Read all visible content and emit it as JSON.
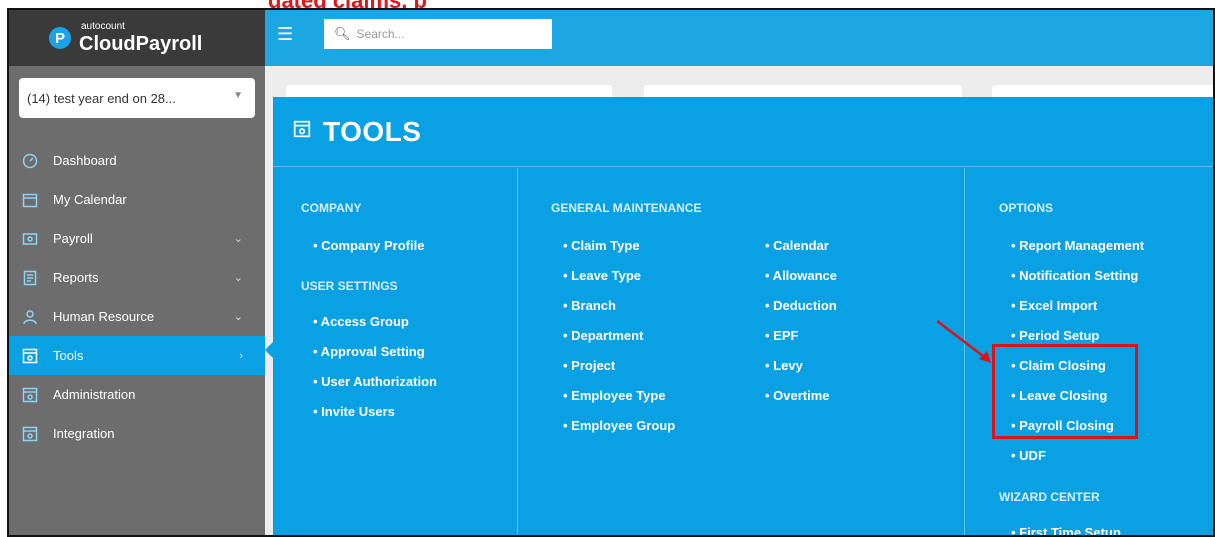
{
  "top_caption": "gated claims, p",
  "brand": {
    "logo_letter": "P",
    "small": "autocount",
    "name": "CloudPayroll"
  },
  "company_select": {
    "value": "(14) test year end on 28..."
  },
  "search": {
    "placeholder": "Search..."
  },
  "sidebar": {
    "items": [
      {
        "label": "Dashboard",
        "icon": "dashboard-icon"
      },
      {
        "label": "My Calendar",
        "icon": "calendar-icon"
      },
      {
        "label": "Payroll",
        "icon": "payroll-icon"
      },
      {
        "label": "Reports",
        "icon": "reports-icon"
      },
      {
        "label": "Human Resource",
        "icon": "human-resource-icon"
      },
      {
        "label": "Tools",
        "icon": "tools-icon"
      },
      {
        "label": "Administration",
        "icon": "administration-icon"
      },
      {
        "label": "Integration",
        "icon": "integration-icon"
      }
    ]
  },
  "tools": {
    "title": "TOOLS",
    "company": {
      "title": "COMPANY",
      "links": [
        "• Company Profile"
      ]
    },
    "user_settings": {
      "title": "USER SETTINGS",
      "links": [
        "• Access Group",
        "• Approval Setting",
        "• User Authorization",
        "• Invite Users"
      ]
    },
    "general_maintenance": {
      "title": "GENERAL MAINTENANCE",
      "col1": [
        "• Claim Type",
        "• Leave Type",
        "• Branch",
        "• Department",
        "• Project",
        "• Employee Type",
        "• Employee Group"
      ],
      "col2": [
        "• Calendar",
        "• Allowance",
        "• Deduction",
        "• EPF",
        "• Levy",
        "• Overtime"
      ]
    },
    "options": {
      "title": "OPTIONS",
      "links": [
        "• Report Management",
        "• Notification Setting",
        "• Excel Import",
        "• Period Setup",
        "• Claim Closing",
        "• Leave Closing",
        "• Payroll Closing",
        "• UDF"
      ]
    },
    "wizard_center": {
      "title": "WIZARD CENTER",
      "links": [
        "• First Time Setup"
      ]
    }
  },
  "colors": {
    "accent": "#0aa1e4",
    "sidebar": "#6d6d6d",
    "highlight": "#d9121b"
  }
}
